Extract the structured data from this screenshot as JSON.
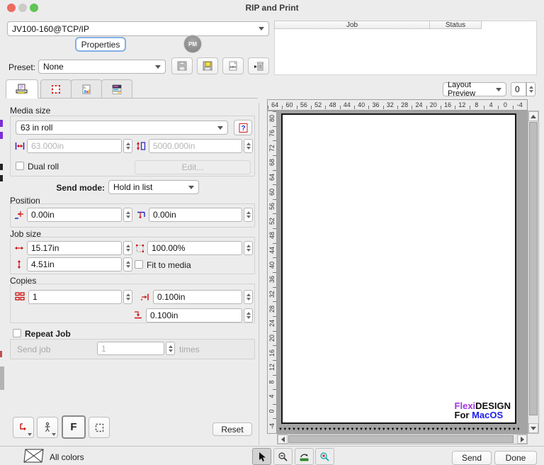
{
  "titlebar": {
    "title": "RIP and Print"
  },
  "printer": {
    "value": "JV100-160@TCP/IP"
  },
  "actions": {
    "properties": "Properties",
    "pm_badge": "PM"
  },
  "preset": {
    "label": "Preset:",
    "value": "None"
  },
  "media": {
    "label": "Media size",
    "roll": "63 in roll",
    "width": "63.000in",
    "height": "5000.000in",
    "dual_roll": "Dual roll",
    "edit": "Edit...",
    "send_mode_label": "Send mode:",
    "send_mode": "Hold in list"
  },
  "position": {
    "label": "Position",
    "x": "0.00in",
    "y": "0.00in"
  },
  "job_size": {
    "label": "Job size",
    "width": "15.17in",
    "scale": "100.00%",
    "height": "4.51in",
    "fit_to_media": "Fit to media"
  },
  "copies": {
    "label": "Copies",
    "count": "1",
    "gap_x": "0.100in",
    "gap_y": "0.100in"
  },
  "repeat_job": {
    "checkbox": "Repeat Job",
    "send_job": "Send job",
    "count": "1",
    "times": "times"
  },
  "tools_left": {
    "f_label": "F",
    "reset": "Reset"
  },
  "job_list": {
    "columns": [
      "Job",
      "Status"
    ]
  },
  "preview": {
    "layout_preview": "Layout Preview",
    "zoom_value": "0",
    "h_ruler": [
      "64",
      "60",
      "56",
      "52",
      "48",
      "44",
      "40",
      "36",
      "32",
      "28",
      "24",
      "20",
      "16",
      "12",
      "8",
      "4",
      "0",
      "-4"
    ],
    "v_ruler": [
      "80",
      "76",
      "72",
      "68",
      "64",
      "60",
      "56",
      "52",
      "48",
      "44",
      "40",
      "36",
      "32",
      "28",
      "24",
      "20",
      "16",
      "12",
      "8",
      "4",
      "0",
      "-4"
    ],
    "watermark": {
      "flexi": "Flexi",
      "design": "DESIGN",
      "prefix": "For ",
      "macos": "MacOS"
    }
  },
  "bottom": {
    "all_colors": "All colors",
    "send": "Send",
    "done": "Done"
  },
  "icons": {
    "traffic_lights": [
      "close-icon",
      "minimize-icon",
      "zoom-icon"
    ],
    "preset_buttons": [
      "save-icon",
      "save-as-icon",
      "rename-abc-icon",
      "delete-trash-icon"
    ],
    "tabs": [
      "printer-tab-icon",
      "panels-tab-icon",
      "color-page-tab-icon",
      "separations-tab-icon"
    ],
    "field_icons": [
      "media-width-icon",
      "media-height-icon",
      "pos-x-icon",
      "pos-y-icon",
      "job-width-icon",
      "job-scale-icon",
      "job-height-icon",
      "copies-icon",
      "gap-x-icon",
      "gap-y-icon"
    ],
    "bottom_tools": [
      "select-cursor-icon",
      "zoom-out-icon",
      "fit-media-icon",
      "zoom-job-icon"
    ]
  },
  "colors": {
    "accent_red": "#cc1111",
    "accent_blue": "#2323cc",
    "flexi_purple": "#a335e0",
    "macos_blue": "#1c1cf0",
    "window_bg": "#ececec"
  }
}
